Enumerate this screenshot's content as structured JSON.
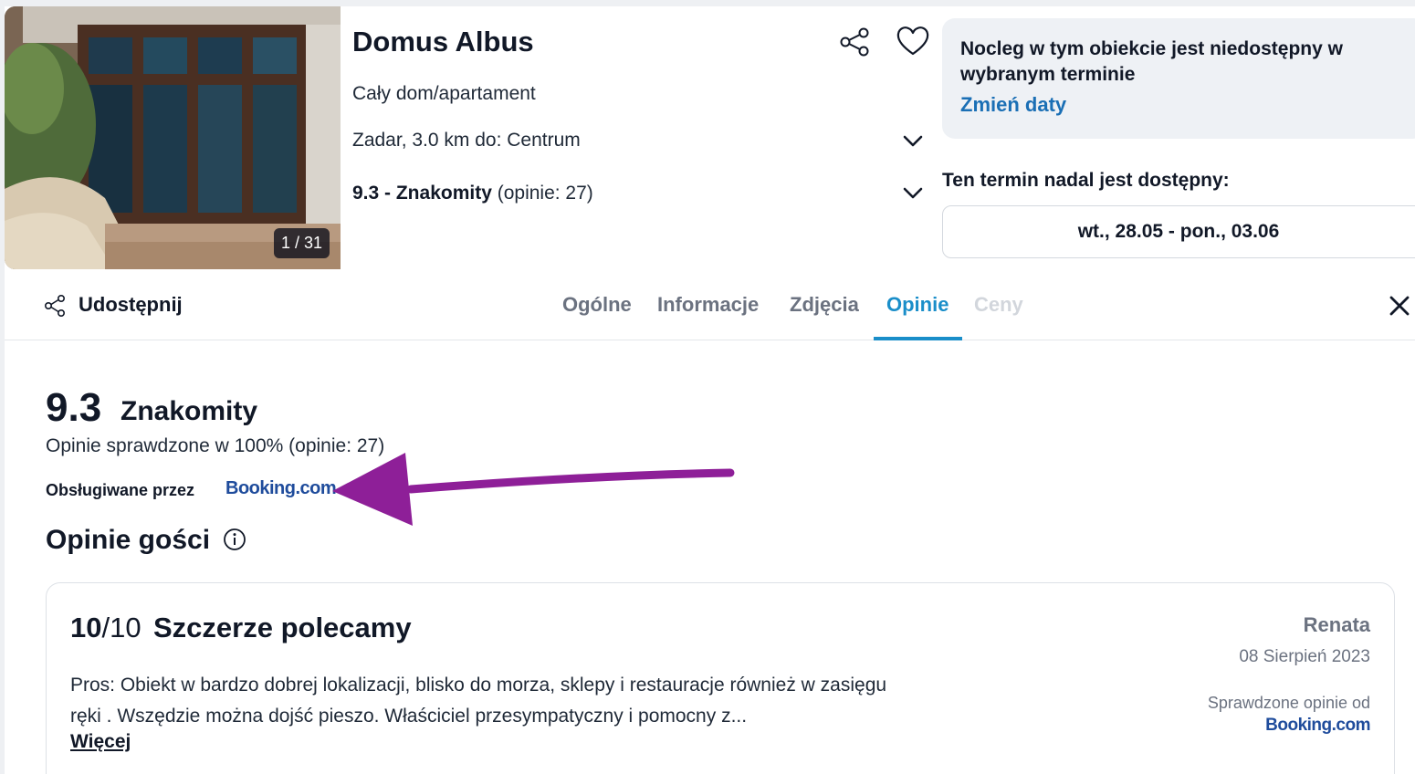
{
  "photo": {
    "counter": "1 / 31"
  },
  "header": {
    "title": "Domus Albus",
    "property_type": "Cały dom/apartament",
    "location": "Zadar, 3.0 km do: Centrum",
    "rating_score_label": "9.3 - Znakomity",
    "rating_count": " (opinie: 27)"
  },
  "availability": {
    "message": "Nocleg w tym obiekcie jest niedostępny w wybranym terminie",
    "change_dates": "Zmień daty",
    "still_available": "Ten termin nadal jest dostępny:",
    "date_range": "wt., 28.05 - pon., 03.06"
  },
  "tabbar": {
    "share_label": "Udostępnij",
    "tabs": [
      {
        "label": "Ogólne"
      },
      {
        "label": "Informacje"
      },
      {
        "label": "Zdjęcia"
      },
      {
        "label": "Opinie"
      },
      {
        "label": "Ceny"
      }
    ],
    "active_tab": "Opinie"
  },
  "score": {
    "value": "9.3",
    "word": "Znakomity",
    "verified": "Opinie sprawdzone w 100% (opinie: 27)",
    "served_by": "Obsługiwane przez",
    "provider": "Booking.com"
  },
  "guest_reviews": {
    "heading": "Opinie gości"
  },
  "review": {
    "score": "10",
    "score_max": "/10",
    "title": "Szczerze polecamy",
    "body": "Pros: Obiekt w bardzo dobrej lokalizacji, blisko do morza, sklepy i restauracje również w zasięgu ręki . Wszędzie można dojść pieszo. Właściciel przesympatyczny i pomocny z...",
    "more": "Więcej",
    "author": "Renata",
    "date": "08 Sierpień 2023",
    "verified_by": "Sprawdzone opinie od",
    "provider": "Booking.com"
  },
  "colors": {
    "accent": "#1a8ec9",
    "link": "#1a6fb5",
    "booking": "#1f4c9c",
    "arrow": "#8e1f98"
  }
}
